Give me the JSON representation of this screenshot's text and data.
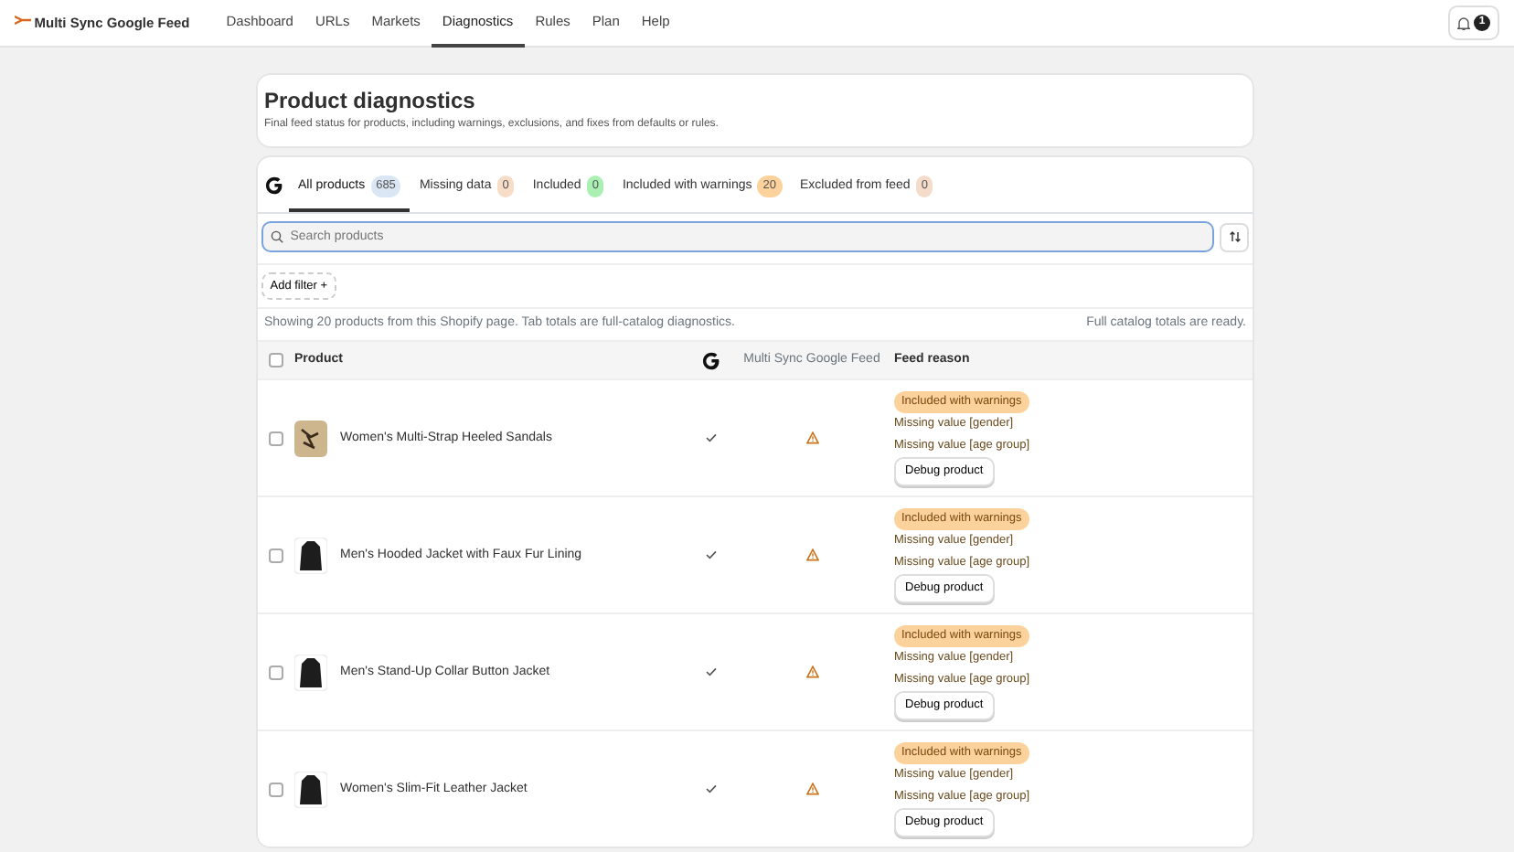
{
  "app": {
    "name": "Multi Sync Google Feed"
  },
  "nav": [
    {
      "label": "Dashboard",
      "selected": false
    },
    {
      "label": "URLs",
      "selected": false
    },
    {
      "label": "Markets",
      "selected": false
    },
    {
      "label": "Diagnostics",
      "selected": true
    },
    {
      "label": "Rules",
      "selected": false
    },
    {
      "label": "Plan",
      "selected": false
    },
    {
      "label": "Help",
      "selected": false
    }
  ],
  "notifications": {
    "count": "1"
  },
  "header": {
    "title": "Product diagnostics",
    "subtitle": "Final feed status for products, including warnings, exclusions, and fixes from defaults or rules."
  },
  "tabs": [
    {
      "label": "All products",
      "count": "685",
      "color": "#dbe6f5",
      "selected": true
    },
    {
      "label": "Missing data",
      "count": "0",
      "color": "#f7dcc8",
      "selected": false
    },
    {
      "label": "Included",
      "count": "0",
      "color": "#a9f0b2",
      "selected": false
    },
    {
      "label": "Included with warnings",
      "count": "20",
      "color": "#fcd29c",
      "selected": false
    },
    {
      "label": "Excluded from feed",
      "count": "0",
      "color": "#f5dcca",
      "selected": false
    }
  ],
  "search": {
    "placeholder": "Search products"
  },
  "add_filter": "Add filter +",
  "info": {
    "left": "Showing 20 products from this Shopify page. Tab totals are full-catalog diagnostics.",
    "right": "Full catalog totals are ready."
  },
  "table": {
    "select_all": {
      "checked": false
    },
    "columns": [
      "Product",
      "Multi Sync Google Feed",
      "Feed reason"
    ],
    "rows": [
      {
        "checked": false,
        "kind": "sandals",
        "product": "Women's Multi-Strap Heeled Sandals",
        "status": "Included with warnings",
        "reasons": [
          "Missing value [gender]",
          "Missing value [age group]"
        ],
        "action": "Debug product"
      },
      {
        "checked": false,
        "kind": "jacket",
        "product": "Men's Hooded Jacket with Faux Fur Lining",
        "status": "Included with warnings",
        "reasons": [
          "Missing value [gender]",
          "Missing value [age group]"
        ],
        "action": "Debug product"
      },
      {
        "checked": false,
        "kind": "jacket",
        "product": "Men's Stand-Up Collar Button Jacket",
        "status": "Included with warnings",
        "reasons": [
          "Missing value [gender]",
          "Missing value [age group]"
        ],
        "action": "Debug product"
      },
      {
        "checked": false,
        "kind": "jacket",
        "product": "Women's Slim-Fit Leather Jacket",
        "status": "Included with warnings",
        "reasons": [
          "Missing value [gender]",
          "Missing value [age group]"
        ],
        "action": "Debug product"
      }
    ]
  }
}
